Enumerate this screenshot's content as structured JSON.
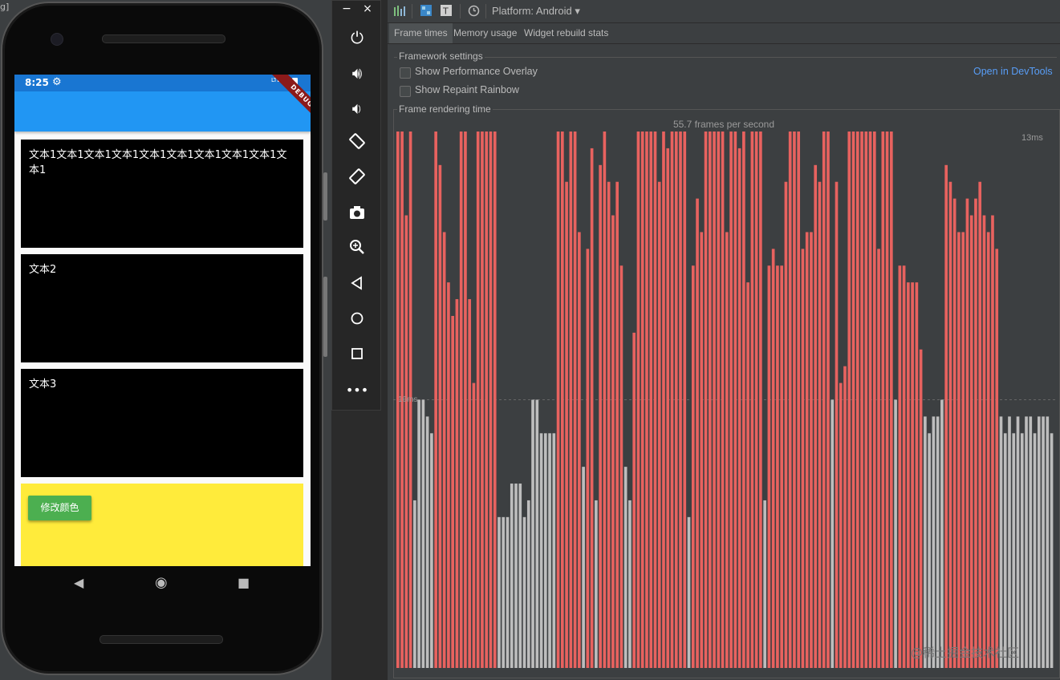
{
  "corner_text": "g]",
  "phone": {
    "status_time": "8:25",
    "status_network": "LTE",
    "debug_banner": "DEBUG",
    "cards": [
      {
        "text": "文本1文本1文本1文本1文本1文本1文本1文本1文本1文本1"
      },
      {
        "text": "文本2"
      },
      {
        "text": "文本3"
      }
    ],
    "button_label": "修改颜色"
  },
  "emulator": {
    "minimize": "−",
    "close": "×",
    "icons": [
      "power-icon",
      "volume-up-icon",
      "volume-down-icon",
      "rotate-left-icon",
      "rotate-right-icon",
      "camera-icon",
      "zoom-icon",
      "back-icon",
      "home-icon",
      "overview-icon",
      "more-icon"
    ]
  },
  "inspector": {
    "platform_label": "Platform: Android",
    "tabs": [
      "Frame times",
      "Memory usage",
      "Widget rebuild stats"
    ],
    "selected_tab": "Frame times",
    "framework_title": "Framework settings",
    "option_overlay": "Show Performance Overlay",
    "option_rainbow": "Show Repaint Rainbow",
    "open_devtools": "Open in DevTools",
    "frame_title": "Frame rendering time",
    "fps_text": "55.7 frames per second",
    "label_13ms": "13ms",
    "label_16ms": "16ms"
  },
  "watermark": "@稀土掘金技术社区",
  "colors": {
    "slow_frame": "#e8625f",
    "normal_frame": "#bdbdbd",
    "accent": "#589df6"
  },
  "chart_data": {
    "type": "bar",
    "title": "Frame rendering time",
    "subtitle": "55.7 frames per second",
    "xlabel": "",
    "ylabel": "",
    "reference_lines": [
      13,
      16
    ],
    "ylim": [
      0,
      32
    ],
    "values": [
      32,
      32,
      27,
      32,
      10,
      16,
      16,
      15,
      14,
      32,
      30,
      26,
      23,
      21,
      22,
      32,
      32,
      22,
      17,
      32,
      32,
      32,
      32,
      32,
      9,
      9,
      9,
      11,
      11,
      11,
      9,
      10,
      16,
      16,
      14,
      14,
      14,
      14,
      32,
      32,
      29,
      32,
      32,
      26,
      12,
      25,
      31,
      10,
      30,
      32,
      29,
      27,
      29,
      24,
      12,
      10,
      20,
      32,
      32,
      32,
      32,
      32,
      29,
      32,
      31,
      32,
      32,
      32,
      32,
      9,
      24,
      28,
      26,
      32,
      32,
      32,
      32,
      32,
      26,
      32,
      32,
      31,
      32,
      23,
      32,
      32,
      32,
      10,
      24,
      25,
      24,
      24,
      29,
      32,
      32,
      32,
      25,
      26,
      26,
      30,
      29,
      32,
      32,
      16,
      29,
      17,
      18,
      32,
      32,
      32,
      32,
      32,
      32,
      32,
      25,
      32,
      32,
      32,
      16,
      24,
      24,
      23,
      23,
      23,
      19,
      15,
      14,
      15,
      15,
      16,
      30,
      29,
      28,
      26,
      26,
      28,
      27,
      28,
      29,
      27,
      26,
      27,
      25,
      15,
      14,
      15,
      14,
      15,
      14,
      15,
      15,
      14,
      15,
      15,
      15,
      14
    ],
    "slow_threshold": 16
  }
}
